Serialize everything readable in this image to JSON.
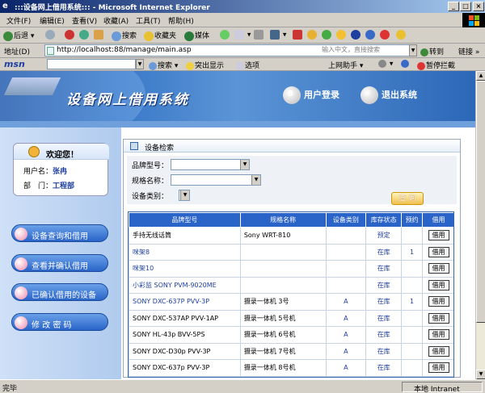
{
  "window": {
    "title": ":::设备网上借用系统::: - Microsoft Internet Explorer",
    "btn_min": "_",
    "btn_max": "□",
    "btn_close": "×",
    "ie_icon": "e"
  },
  "menu": [
    "文件(F)",
    "编辑(E)",
    "查看(V)",
    "收藏(A)",
    "工具(T)",
    "帮助(H)"
  ],
  "toolbar": {
    "back": "后退",
    "search": "搜索",
    "favorites": "收藏夹",
    "media": "媒体"
  },
  "address": {
    "label": "地址(D)",
    "url": "http://localhost:88/manage/main.asp",
    "hint": "输入中文，直接搜索",
    "go": "转到",
    "links": "链接",
    "dropdown": "▼"
  },
  "msnbar": {
    "logo": "msn",
    "search": "搜索",
    "highlight": "突出显示",
    "options": "选项",
    "online": "上网助手",
    "block": "暂停拦截"
  },
  "banner": {
    "site_title": "设备网上借用系统",
    "login": "用户登录",
    "logout": "退出系统",
    "login_icon": "8",
    "logout_icon": "⚡"
  },
  "welcome": {
    "title": "欢迎您！",
    "username_label": "用户名：",
    "username": "张冉",
    "dept_label": "部　门：",
    "dept": "工程部"
  },
  "nav": [
    {
      "label": "设备查询和借用"
    },
    {
      "label": "查看并确认借用"
    },
    {
      "label": "已确认借用的设备"
    },
    {
      "label": "修 改 密 码"
    }
  ],
  "panel": {
    "title": "设备检索",
    "brand_label": "品牌型号：",
    "spec_label": "规格名称：",
    "category_label": "设备类别：",
    "query_button": "查 询",
    "select_arrow": "▼"
  },
  "grid": {
    "headers": [
      "品牌型号",
      "规格名称",
      "设备类别",
      "库存状态",
      "预约",
      "借用"
    ],
    "rows": [
      {
        "brand": "手持无线话筒",
        "spec": "Sony WRT-810",
        "category": "",
        "status": "预定",
        "reserve": "",
        "action": "借用",
        "link": false
      },
      {
        "brand": "咪架8",
        "spec": "",
        "category": "",
        "status": "在库",
        "reserve": "1",
        "action": "借用",
        "link": true
      },
      {
        "brand": "咪架10",
        "spec": "",
        "category": "",
        "status": "在库",
        "reserve": "",
        "action": "借用",
        "link": true
      },
      {
        "brand": "小彩监 SONY PVM-9020ME",
        "spec": "",
        "category": "",
        "status": "在库",
        "reserve": "",
        "action": "借用",
        "link": true
      },
      {
        "brand": "SONY DXC-637P PVV-3P",
        "spec": "摄录一体机 3号",
        "category": "A",
        "status": "在库",
        "reserve": "1",
        "action": "借用",
        "link": true
      },
      {
        "brand": "SONY DXC-537AP PVV-1AP",
        "spec": "摄录一体机 5号机",
        "category": "A",
        "status": "在库",
        "reserve": "",
        "action": "借用",
        "link": false
      },
      {
        "brand": "SONY HL-43p BVV-5PS",
        "spec": "摄录一体机 6号机",
        "category": "A",
        "status": "在库",
        "reserve": "",
        "action": "借用",
        "link": false
      },
      {
        "brand": "SONY DXC-D30p PVV-3P",
        "spec": "摄录一体机 7号机",
        "category": "A",
        "status": "在库",
        "reserve": "",
        "action": "借用",
        "link": false
      },
      {
        "brand": "SONY DXC-637p PVV-3P",
        "spec": "摄录一体机 8号机",
        "category": "A",
        "status": "在库",
        "reserve": "",
        "action": "借用",
        "link": false
      }
    ]
  },
  "status": {
    "text": "完毕",
    "zone": "本地 Intranet"
  },
  "scroll": {
    "up": "▲",
    "down": "▼"
  }
}
